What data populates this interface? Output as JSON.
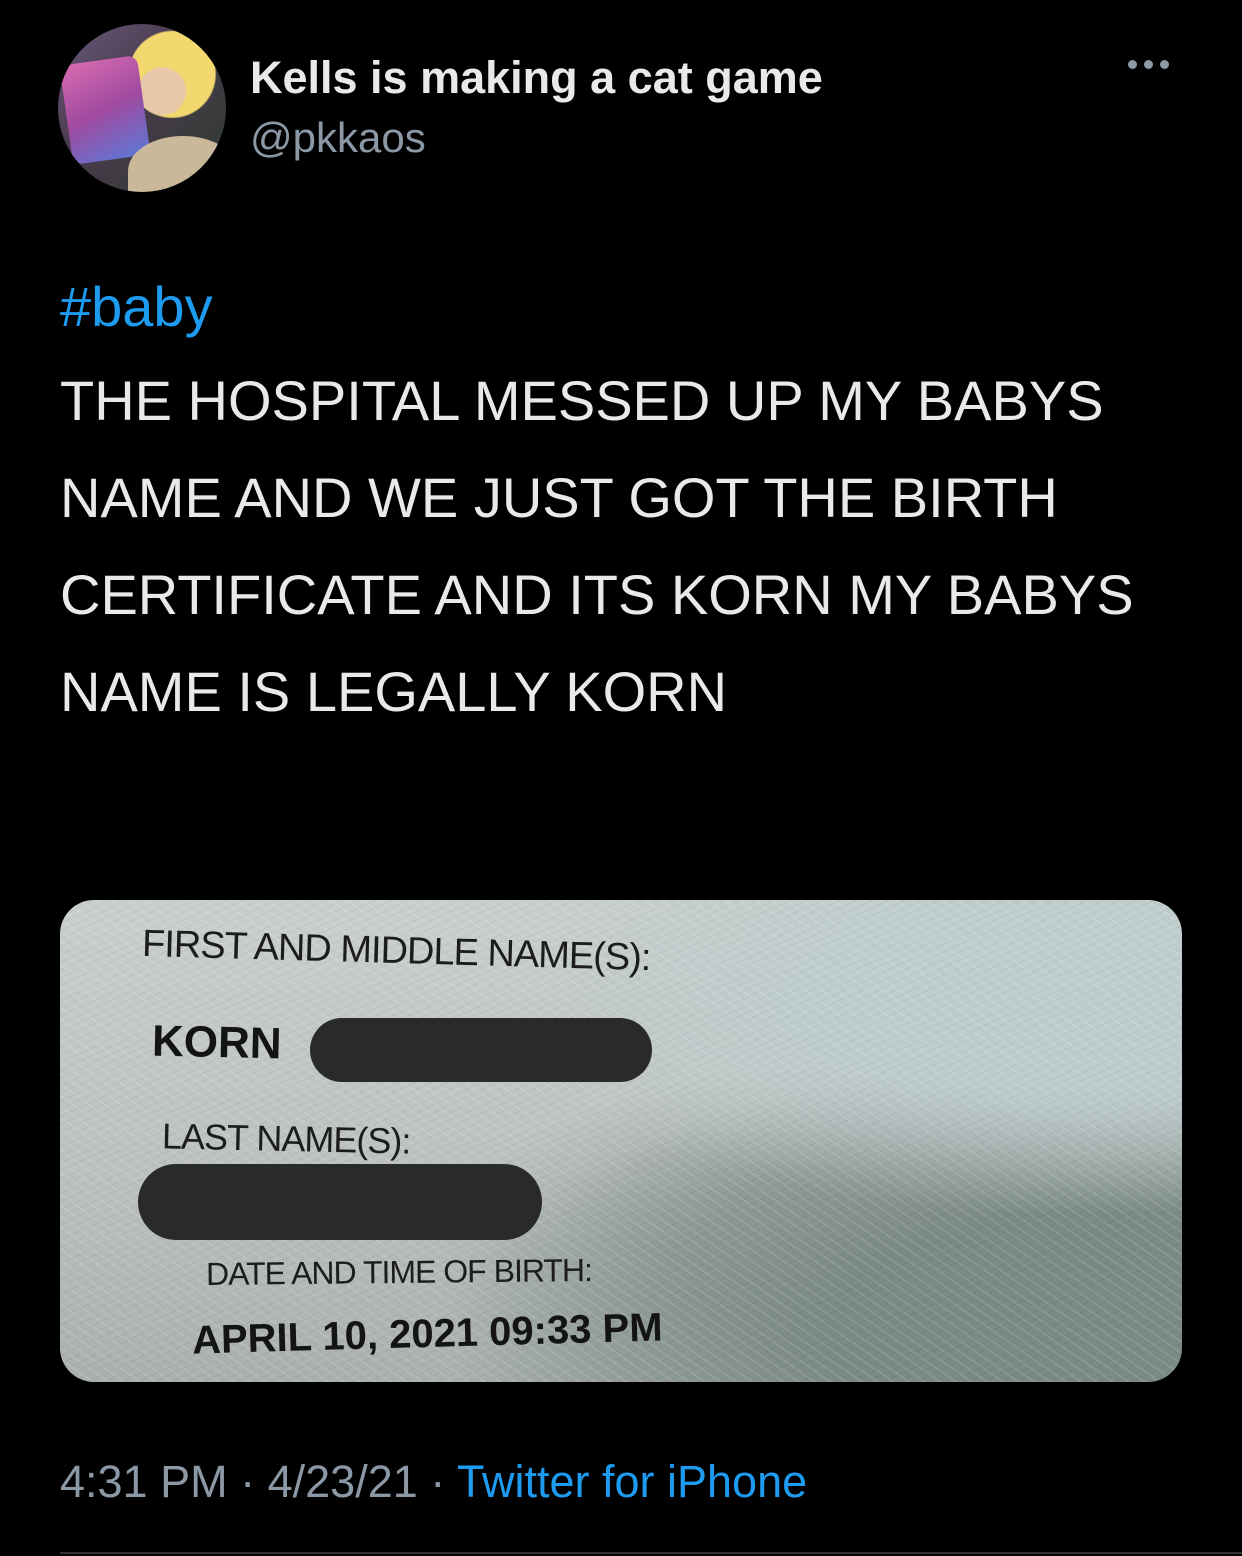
{
  "author": {
    "display_name": "Kells is making a cat game",
    "handle": "@pkkaos",
    "avatar_icon": "profile-photo"
  },
  "more_icon": "ellipsis-icon",
  "tweet": {
    "hashtag": "#baby",
    "text": "THE HOSPITAL MESSED UP MY BABYS NAME AND WE JUST GOT THE BIRTH CERTIFICATE AND ITS KORN MY BABYS NAME IS LEGALLY KORN"
  },
  "media": {
    "first_middle_label": "FIRST AND MIDDLE NAME(S):",
    "first_name_value": "KORN",
    "last_name_label": "LAST NAME(S):",
    "birth_label": "DATE AND TIME OF BIRTH:",
    "birth_value": "APRIL 10, 2021   09:33 PM"
  },
  "meta": {
    "time": "4:31 PM",
    "separator": "·",
    "date": "4/23/21",
    "source": "Twitter for iPhone"
  },
  "colors": {
    "background": "#000000",
    "text": "#e7e9ea",
    "secondary": "#8b98a5",
    "link": "#1d9bf0"
  }
}
